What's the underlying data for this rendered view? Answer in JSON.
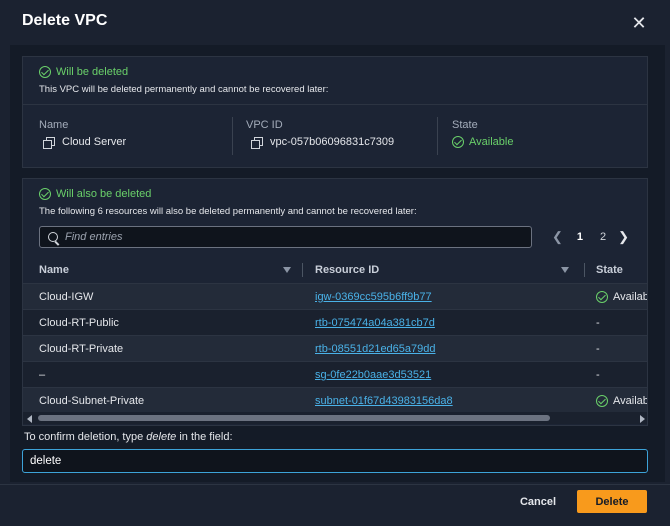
{
  "dialog": {
    "title": "Delete VPC",
    "close_icon": "close-icon"
  },
  "vpc_panel": {
    "heading": "Will be deleted",
    "description": "This VPC will be deleted permanently and cannot be recovered later:",
    "name_label": "Name",
    "name_value": "Cloud Server",
    "vpcid_label": "VPC ID",
    "vpcid_value": "vpc-057b06096831c7309",
    "state_label": "State",
    "state_value": "Available"
  },
  "resources_panel": {
    "heading": "Will also be deleted",
    "description": "The following 6 resources will also be deleted permanently and cannot be recovered later:",
    "search_placeholder": "Find entries",
    "pagination": {
      "current": "1",
      "next": "2"
    },
    "columns": {
      "name": "Name",
      "resource_id": "Resource ID",
      "state": "State"
    },
    "rows": [
      {
        "name": "Cloud-IGW",
        "resource_id": "igw-0369cc595b6ff9b77",
        "state": "Availab",
        "state_ok": true
      },
      {
        "name": "Cloud-RT-Public",
        "resource_id": "rtb-075474a04a381cb7d",
        "state": "-",
        "state_ok": false
      },
      {
        "name": "Cloud-RT-Private",
        "resource_id": "rtb-08551d21ed65a79dd",
        "state": "-",
        "state_ok": false
      },
      {
        "name": "–",
        "resource_id": "sg-0fe22b0aae3d53521",
        "state": "-",
        "state_ok": false
      },
      {
        "name": "Cloud-Subnet-Private",
        "resource_id": "subnet-01f67d43983156da8",
        "state": "Availab",
        "state_ok": true
      }
    ]
  },
  "confirm": {
    "label_prefix": "To confirm deletion, type ",
    "label_keyword": "delete",
    "label_suffix": " in the field:",
    "input_value": "delete"
  },
  "footer": {
    "cancel_label": "Cancel",
    "delete_label": "Delete"
  },
  "colors": {
    "accent": "#f89a1c",
    "success": "#6ad06a",
    "link": "#4ab2e8",
    "focus": "#3da3d8"
  }
}
